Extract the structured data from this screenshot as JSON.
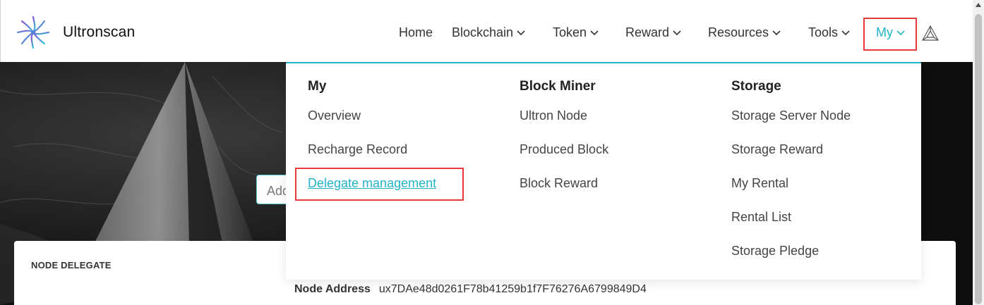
{
  "brand": {
    "name": "Ultronscan",
    "logo_icon": "ultron-star-logo"
  },
  "nav": {
    "items": [
      {
        "label": "Home",
        "has_dropdown": false
      },
      {
        "label": "Blockchain",
        "has_dropdown": true
      },
      {
        "label": "Token",
        "has_dropdown": true
      },
      {
        "label": "Reward",
        "has_dropdown": true
      },
      {
        "label": "Resources",
        "has_dropdown": true
      },
      {
        "label": "Tools",
        "has_dropdown": true
      },
      {
        "label": "My",
        "has_dropdown": true,
        "active": true
      }
    ],
    "network_icon": "network-triangle-icon"
  },
  "search": {
    "placeholder_visible": "Add"
  },
  "dropdown": {
    "columns": [
      {
        "heading": "My",
        "links": [
          "Overview",
          "Recharge Record",
          "Delegate management"
        ]
      },
      {
        "heading": "Block Miner",
        "links": [
          "Ultron Node",
          "Produced Block",
          "Block Reward"
        ]
      },
      {
        "heading": "Storage",
        "links": [
          "Storage Server Node",
          "Storage Reward",
          "My Rental",
          "Rental List",
          "Storage Pledge"
        ]
      }
    ],
    "highlighted_link": "Delegate management"
  },
  "card": {
    "title": "NODE DELEGATE",
    "node_address_label": "Node Address",
    "node_address_value": "ux7DAe48d0261F78b41259b1f7F76276A6799849D4"
  },
  "colors": {
    "accent": "#21b4c6",
    "highlight_border": "#e5393b",
    "hero_bg": "#151515"
  }
}
